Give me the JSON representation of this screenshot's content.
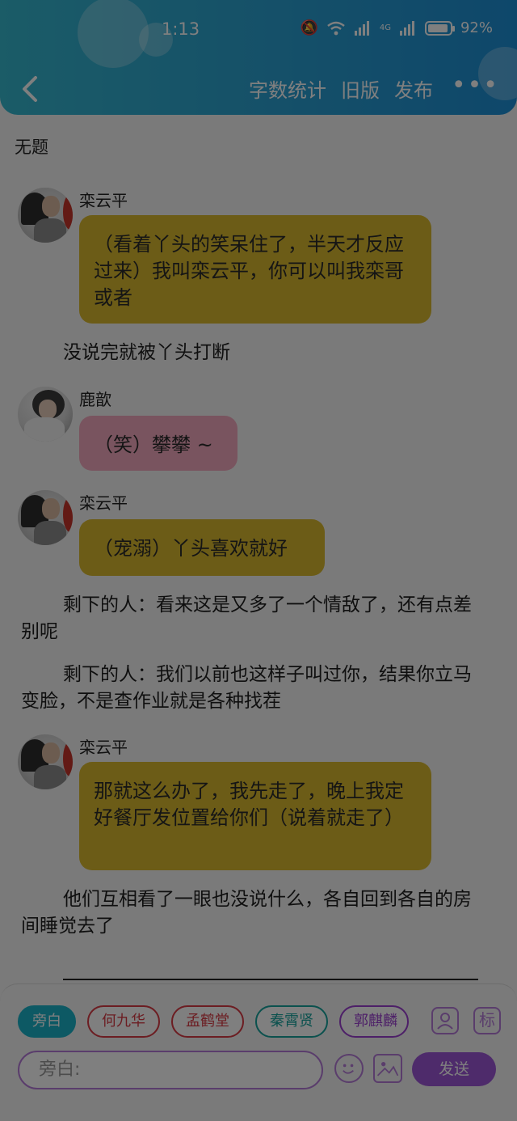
{
  "status": {
    "time": "1:13",
    "battery": "92%",
    "battery_level": 0.92,
    "network": "4G"
  },
  "header": {
    "actions": [
      "字数统计",
      "旧版",
      "发布"
    ],
    "more": "•••"
  },
  "title": "无题",
  "messages": [
    {
      "type": "chat",
      "name": "栾云平",
      "text": "（看着丫头的笑呆住了，半天才反应过来）我叫栾云平，你可以叫我栾哥或者",
      "color": "#d9b92f"
    },
    {
      "type": "narration",
      "text": "没说完就被丫头打断"
    },
    {
      "type": "chat",
      "name": "鹿歆",
      "text": "（笑）攀攀 ~",
      "color": "#f3a9be"
    },
    {
      "type": "chat",
      "name": "栾云平",
      "text": "（宠溺）丫头喜欢就好",
      "color": "#d9b92f"
    },
    {
      "type": "narration",
      "text": "剩下的人：看来这是又多了一个情敌了，还有点差别呢"
    },
    {
      "type": "narration",
      "text": "剩下的人：我们以前也这样子叫过你，结果你立马变脸，不是查作业就是各种找茬"
    },
    {
      "type": "chat",
      "name": "栾云平",
      "text": "那就这么办了，我先走了，晚上我定好餐厅发位置给你们（说着就走了）",
      "color": "#d9b92f"
    },
    {
      "type": "narration",
      "text": "他们互相看了一眼也没说什么，各自回到各自的房间睡觉去了"
    }
  ],
  "roles": [
    "旁白",
    "何九华",
    "孟鹤堂",
    "秦霄贤",
    "郭麒麟"
  ],
  "toolbar": {
    "icon_label": "标"
  },
  "composer": {
    "placeholder": "旁白:",
    "send": "发送"
  }
}
